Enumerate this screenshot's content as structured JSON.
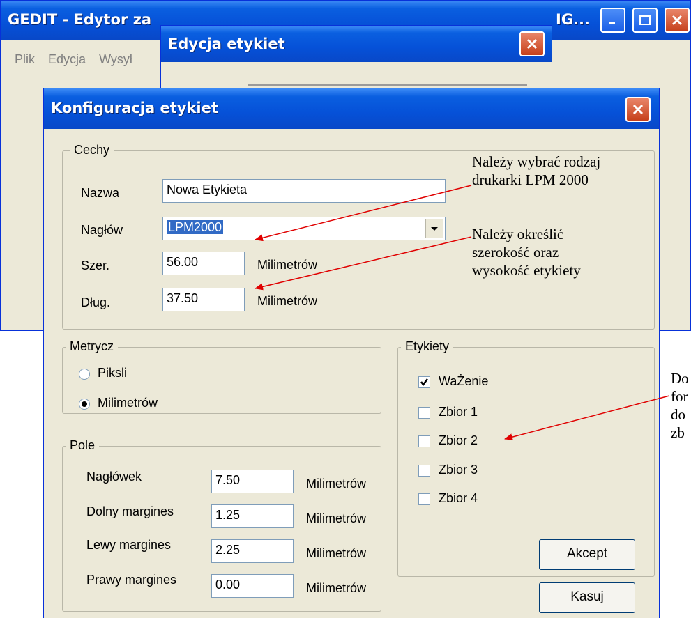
{
  "main_window": {
    "title_left": "GEDIT - Edytor za",
    "title_right": "IG...",
    "menu": [
      "Plik",
      "Edycja",
      "Wysył"
    ]
  },
  "edit_window": {
    "title": "Edycja etykiet"
  },
  "config_dialog": {
    "title": "Konfiguracja etykiet",
    "cechy": {
      "title": "Cechy",
      "name_label": "Nazwa",
      "name_value": "Nowa Etykieta",
      "header_label": "Nagłów",
      "header_value": "LPM2000",
      "width_label": "Szer.",
      "width_value": "56.00",
      "width_unit": "Milimetrów",
      "length_label": "Dług.",
      "length_value": "37.50",
      "length_unit": "Milimetrów"
    },
    "metrycz": {
      "title": "Metrycz",
      "options": [
        {
          "label": "Piksli",
          "selected": false
        },
        {
          "label": "Milimetrów",
          "selected": true
        }
      ]
    },
    "pole": {
      "title": "Pole",
      "rows": [
        {
          "label": "Nagłówek",
          "value": "7.50",
          "unit": "Milimetrów"
        },
        {
          "label": "Dolny margines",
          "value": "1.25",
          "unit": "Milimetrów"
        },
        {
          "label": "Lewy margines",
          "value": "2.25",
          "unit": "Milimetrów"
        },
        {
          "label": "Prawy margines",
          "value": "0.00",
          "unit": "Milimetrów"
        }
      ]
    },
    "etykiety": {
      "title": "Etykiety",
      "items": [
        {
          "label": "WaŻenie",
          "checked": true
        },
        {
          "label": "Zbior 1",
          "checked": false
        },
        {
          "label": "Zbior 2",
          "checked": false
        },
        {
          "label": "Zbior 3",
          "checked": false
        },
        {
          "label": "Zbior 4",
          "checked": false
        }
      ]
    },
    "buttons": {
      "accept": "Akcept",
      "cancel": "Kasuj"
    }
  },
  "annotations": {
    "printer": [
      "Należy wybrać rodzaj",
      "drukarki LPM 2000"
    ],
    "size": [
      "Należy określić",
      "szerokość oraz",
      "wysokość etykiety"
    ],
    "sets": [
      "Do",
      "for",
      "do",
      "zb"
    ]
  },
  "colors": {
    "title_blue": "#0a5fe0",
    "dialog_bg": "#ece9d8",
    "arrow": "#e00000",
    "select_blue": "#316ac5"
  }
}
